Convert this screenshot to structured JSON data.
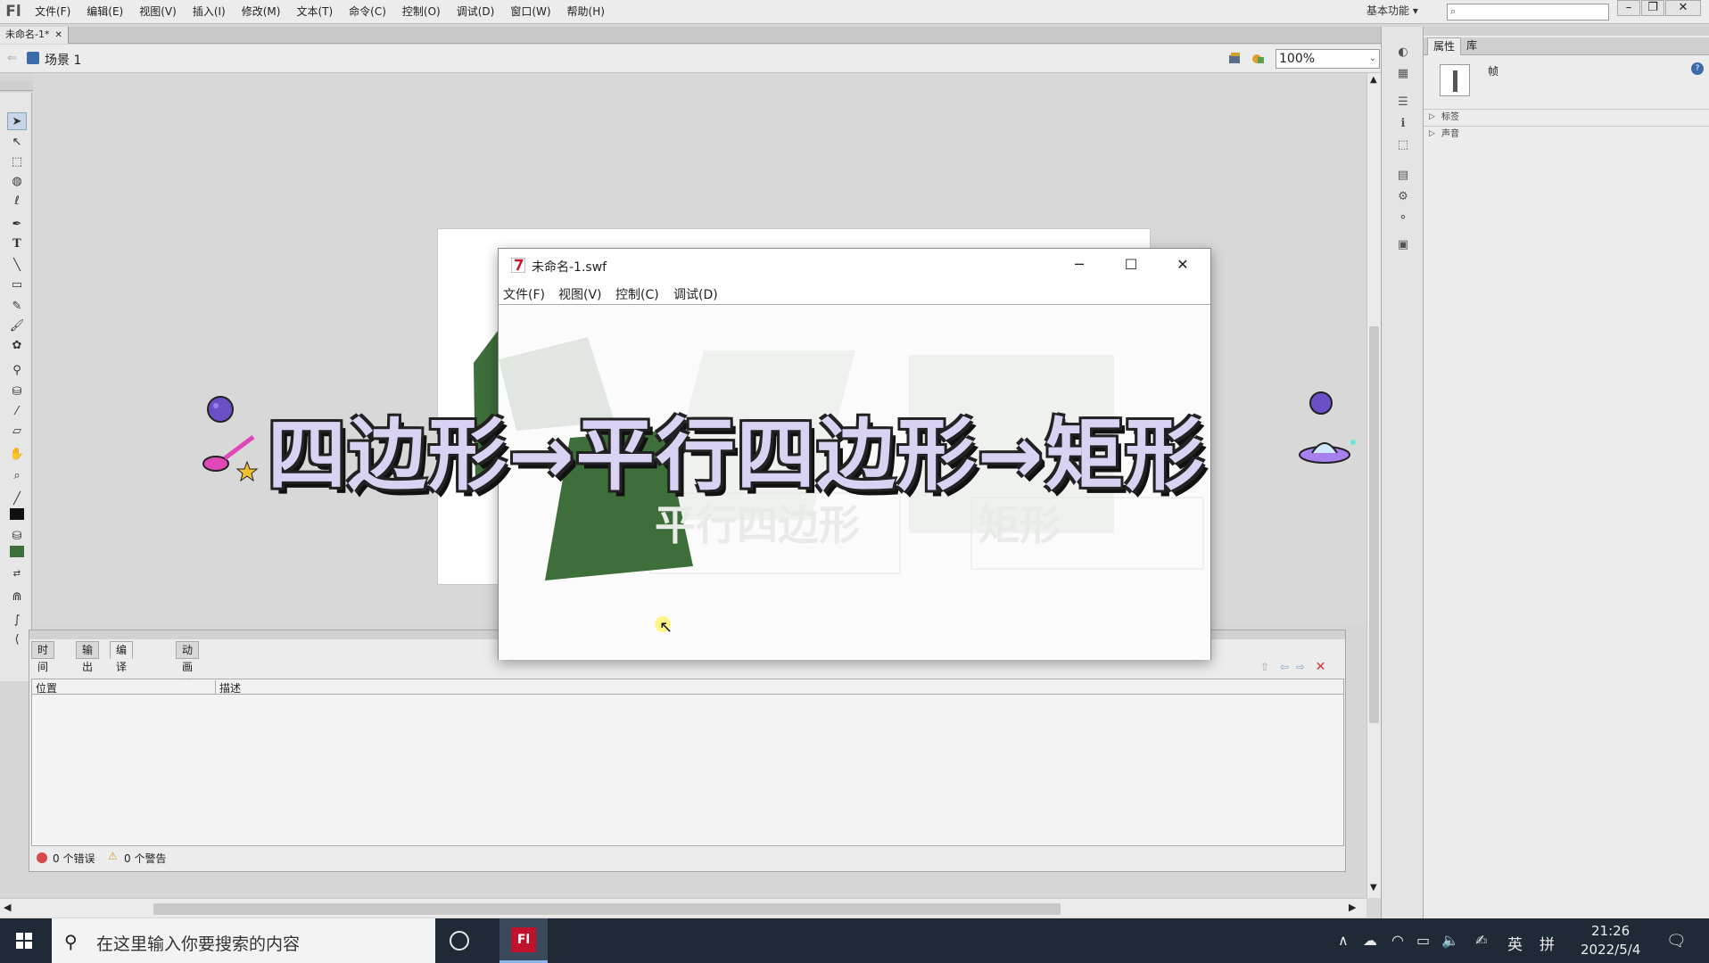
{
  "app": {
    "logo": "Fl",
    "menu": [
      "文件(F)",
      "编辑(E)",
      "视图(V)",
      "插入(I)",
      "修改(M)",
      "文本(T)",
      "命令(C)",
      "控制(O)",
      "调试(D)",
      "窗口(W)",
      "帮助(H)"
    ],
    "workspace": "基本功能",
    "search_placeholder": ""
  },
  "document": {
    "tab_label": "未命名-1*",
    "scene_label": "场景 1",
    "zoom": "100%"
  },
  "properties_panel": {
    "tabs": [
      "属性",
      "库"
    ],
    "frame_label": "帧",
    "sections": [
      "标签",
      "声音"
    ]
  },
  "bottom_panel": {
    "tabs": [
      "时间轴",
      "输出",
      "编译器错误",
      "动画编辑器"
    ],
    "active_tab": "编译器错误",
    "columns": [
      "位置",
      "描述"
    ],
    "errors_label": "0 个错误",
    "warnings_label": "0 个警告"
  },
  "swf_window": {
    "title": "未命名-1.swf",
    "menu": [
      "文件(F)",
      "视图(V)",
      "控制(C)",
      "调试(D)"
    ],
    "faded_labels": [
      "平行四边形",
      "矩形"
    ]
  },
  "overlay": {
    "banner": "四边形→平行四边形→矩形"
  },
  "taskbar": {
    "search_text": "在这里输入你要搜索的内容",
    "ime_lang": "英",
    "ime_mode": "拼",
    "time": "21:26",
    "date": "2022/5/4"
  },
  "colors": {
    "shape_green": "#3e6e3a",
    "flash_red": "#c0122b",
    "taskbar": "#1f2a36"
  }
}
